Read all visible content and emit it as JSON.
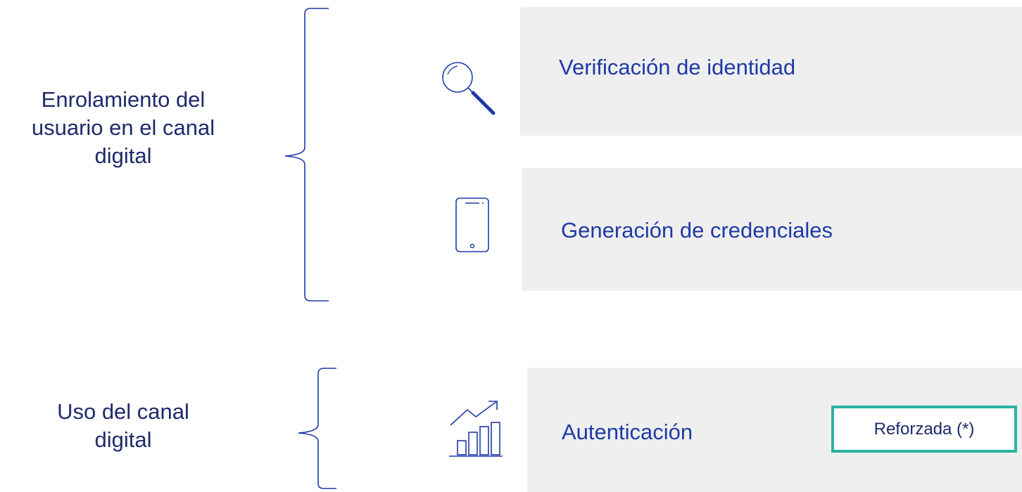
{
  "groups": {
    "enrolment": {
      "lines": [
        "Enrolamiento del",
        "usuario en el canal",
        "digital"
      ]
    },
    "usage": {
      "lines": [
        "Uso del canal",
        "digital"
      ]
    }
  },
  "steps": [
    {
      "label": "Verificación de identidad",
      "icon": "magnifier-icon"
    },
    {
      "label": "Generación de credenciales",
      "icon": "smartphone-icon"
    },
    {
      "label": "Autenticación",
      "icon": "growth-chart-icon"
    }
  ],
  "badge": {
    "label": "Reforzada (*)"
  },
  "colors": {
    "heading": "#1f2a6b",
    "step_text": "#1f3aa6",
    "panel": "#efefef",
    "badge_border": "#2bb3a0",
    "icon_stroke": "#1f3aa6"
  }
}
